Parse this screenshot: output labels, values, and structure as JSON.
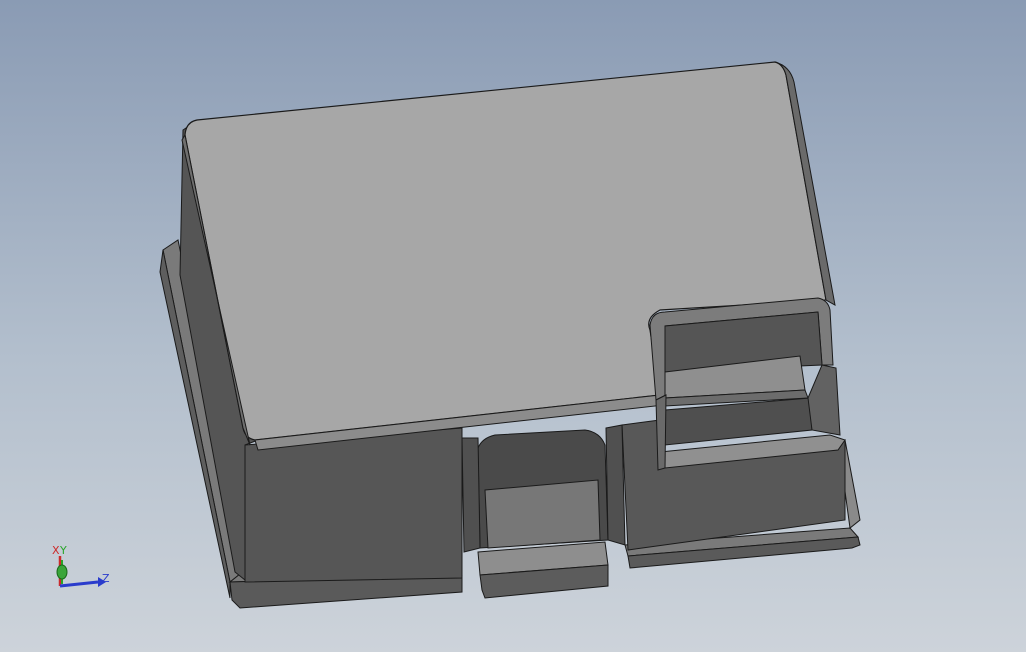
{
  "viewport": {
    "background_top": "#8a9bb4",
    "background_bottom": "#cdd3da"
  },
  "model": {
    "top_color": "#a5a5a5",
    "side_color": "#5a5a5a",
    "dark_side_color": "#4a4a4a",
    "flange_color": "#6e6e6e",
    "edge_color": "#1a1a1a"
  },
  "triad": {
    "x_label": "X",
    "y_label": "Y",
    "z_label": "Z",
    "x_color": "#cc2a2a",
    "y_color": "#2aa52a",
    "z_color": "#2a3ccc"
  }
}
